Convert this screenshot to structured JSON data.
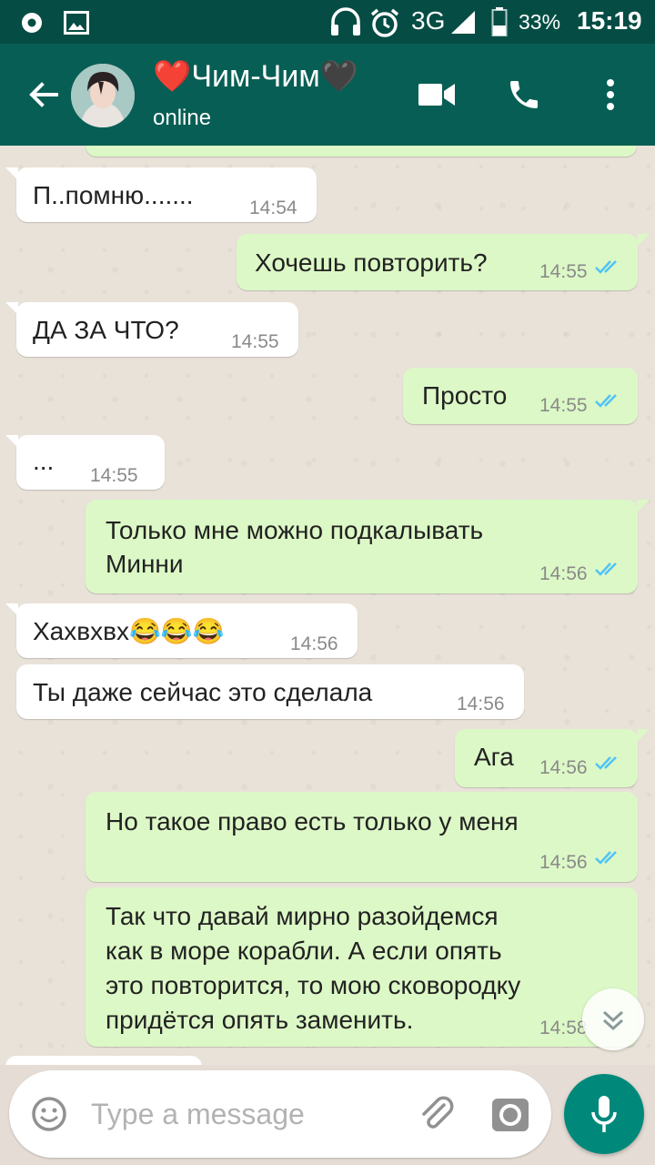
{
  "status": {
    "network": "3G",
    "battery": "33%",
    "time": "15:19"
  },
  "header": {
    "contact_name": "❤️Чим-Чим🖤",
    "status": "online"
  },
  "messages": [
    {
      "text": "П..помню.......",
      "time": "14:54"
    },
    {
      "text": "Хочешь повторить?",
      "time": "14:55"
    },
    {
      "text": "ДА ЗА ЧТО?",
      "time": "14:55"
    },
    {
      "text": "Просто",
      "time": "14:55"
    },
    {
      "text": "...",
      "time": "14:55"
    },
    {
      "line1": "Только мне можно подкалывать",
      "line2": "Минни",
      "time": "14:56"
    },
    {
      "text": "Хахвхвх😂😂😂",
      "time": "14:56"
    },
    {
      "text": "Ты даже сейчас это сделала",
      "time": "14:56"
    },
    {
      "text": "Ага",
      "time": "14:56"
    },
    {
      "text": "Но такое право есть только у меня",
      "time": "14:56"
    },
    {
      "line1": "Так что давай мирно разойдемся",
      "line2": "как в море корабли. А если опять",
      "line3": "это повторится, то мою сковородку",
      "line4": "придётся опять заменить.",
      "time": "14:58"
    }
  ],
  "composer": {
    "placeholder": "Type a message"
  },
  "colors": {
    "header": "#075e54",
    "statusbar": "#054d44",
    "outgoing": "#dcf8c6",
    "incoming": "#ffffff",
    "ticks": "#4fc3f7",
    "accent": "#00897b"
  }
}
